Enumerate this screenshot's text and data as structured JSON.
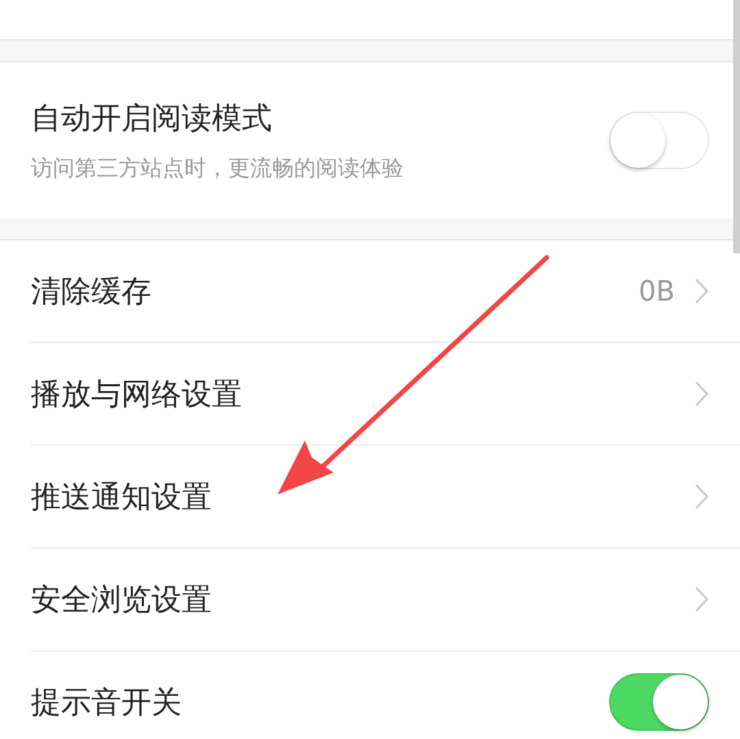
{
  "sections": [
    {
      "items": [
        {
          "kind": "toggle",
          "title": "自动开启阅读模式",
          "subtitle": "访问第三方站点时，更流畅的阅读体验",
          "on": false
        }
      ]
    },
    {
      "items": [
        {
          "kind": "link",
          "title": "清除缓存",
          "value": "0B"
        },
        {
          "kind": "link",
          "title": "播放与网络设置"
        },
        {
          "kind": "link",
          "title": "推送通知设置"
        },
        {
          "kind": "link",
          "title": "安全浏览设置"
        },
        {
          "kind": "toggle",
          "title": "提示音开关",
          "on": true
        }
      ]
    }
  ],
  "annotation": {
    "kind": "arrow"
  }
}
